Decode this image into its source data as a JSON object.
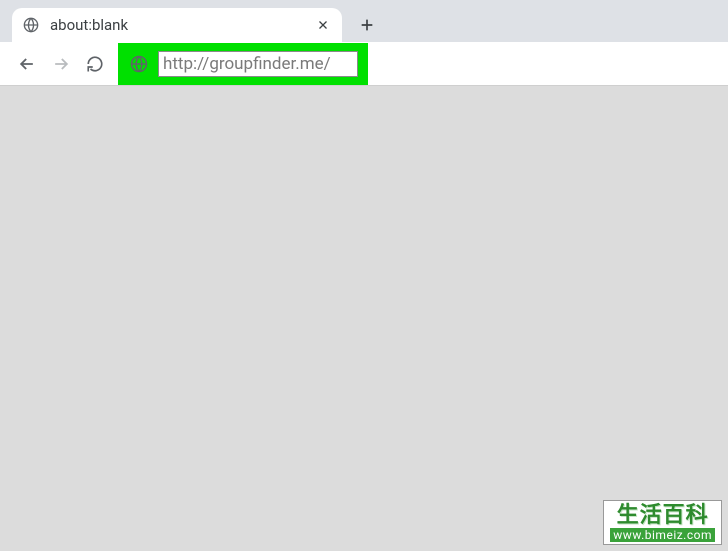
{
  "tab": {
    "title": "about:blank"
  },
  "address_bar": {
    "url": "http://groupfinder.me/"
  },
  "highlight_color": "#00e000",
  "watermark": {
    "text": "生活百科",
    "url": "www.bimeiz.com"
  }
}
